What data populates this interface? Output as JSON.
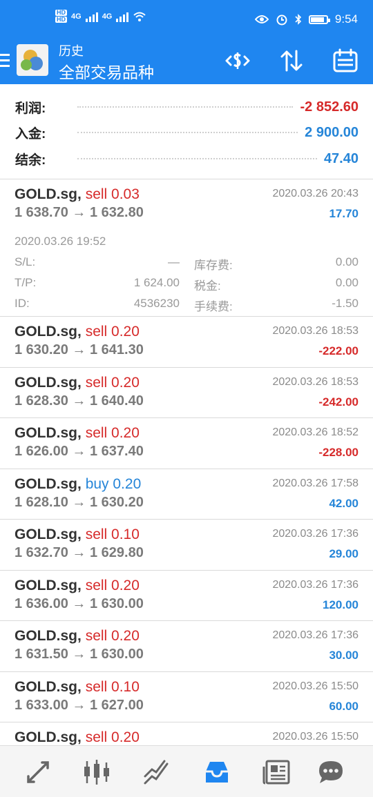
{
  "status": {
    "hd1": "HD",
    "hd2": "HD",
    "net": "4G",
    "net2": "4G",
    "time": "9:54",
    "battery_level": 0.85,
    "icons": [
      "eye-icon",
      "alarm-icon",
      "bluetooth-icon",
      "battery-icon",
      "wifi-icon"
    ]
  },
  "appbar": {
    "subtitle": "历史",
    "title": "全部交易品种",
    "icons": [
      "menu-icon",
      "app-logo",
      "deposit-icon",
      "sort-icon",
      "calendar-icon"
    ]
  },
  "summary": {
    "profit_label": "利润:",
    "profit_value": "-2 852.60",
    "deposit_label": "入金:",
    "deposit_value": "2 900.00",
    "balance_label": "结余:",
    "balance_value": "47.40"
  },
  "trades": [
    {
      "symbol": "GOLD.sg,",
      "side": "sell 0.03",
      "prices": "1 638.70 → 1 632.80",
      "date": "2020.03.26 20:43",
      "profit": "17.70",
      "profit_color": "#2585d8",
      "expanded": true,
      "open_time": "2020.03.26 19:52",
      "sl_label": "S/L:",
      "sl_value": "—",
      "tp_label": "T/P:",
      "tp_value": "1 624.00",
      "id_label": "ID:",
      "id_value": "4536230",
      "swap_label": "库存费:",
      "swap_value": "0.00",
      "tax_label": "税金:",
      "tax_value": "0.00",
      "fee_label": "手续费:",
      "fee_value": "-1.50"
    },
    {
      "symbol": "GOLD.sg,",
      "side": "sell 0.20",
      "prices": "1 630.20 → 1 641.30",
      "date": "2020.03.26 18:53",
      "profit": "-222.00",
      "profit_color": "#d62a2a"
    },
    {
      "symbol": "GOLD.sg,",
      "side": "sell 0.20",
      "prices": "1 628.30 → 1 640.40",
      "date": "2020.03.26 18:53",
      "profit": "-242.00",
      "profit_color": "#d62a2a"
    },
    {
      "symbol": "GOLD.sg,",
      "side": "sell 0.20",
      "prices": "1 626.00 → 1 637.40",
      "date": "2020.03.26 18:52",
      "profit": "-228.00",
      "profit_color": "#d62a2a"
    },
    {
      "symbol": "GOLD.sg,",
      "side": "buy 0.20",
      "prices": "1 628.10 → 1 630.20",
      "date": "2020.03.26 17:58",
      "profit": "42.00",
      "profit_color": "#2585d8"
    },
    {
      "symbol": "GOLD.sg,",
      "side": "sell 0.10",
      "prices": "1 632.70 → 1 629.80",
      "date": "2020.03.26 17:36",
      "profit": "29.00",
      "profit_color": "#2585d8"
    },
    {
      "symbol": "GOLD.sg,",
      "side": "sell 0.20",
      "prices": "1 636.00 → 1 630.00",
      "date": "2020.03.26 17:36",
      "profit": "120.00",
      "profit_color": "#2585d8"
    },
    {
      "symbol": "GOLD.sg,",
      "side": "sell 0.20",
      "prices": "1 631.50 → 1 630.00",
      "date": "2020.03.26 17:36",
      "profit": "30.00",
      "profit_color": "#2585d8"
    },
    {
      "symbol": "GOLD.sg,",
      "side": "sell 0.10",
      "prices": "1 633.00 → 1 627.00",
      "date": "2020.03.26 15:50",
      "profit": "60.00",
      "profit_color": "#2585d8"
    },
    {
      "symbol": "GOLD.sg,",
      "side": "sell 0.20",
      "prices": "",
      "date": "2020.03.26 15:50",
      "profit": "",
      "profit_color": "#2585d8"
    }
  ],
  "bottomnav": {
    "items": [
      "quotes-icon",
      "chart-icon",
      "trade-icon",
      "history-icon",
      "news-icon",
      "chat-icon"
    ],
    "active": "history-icon",
    "active_color": "#1f86f0"
  }
}
